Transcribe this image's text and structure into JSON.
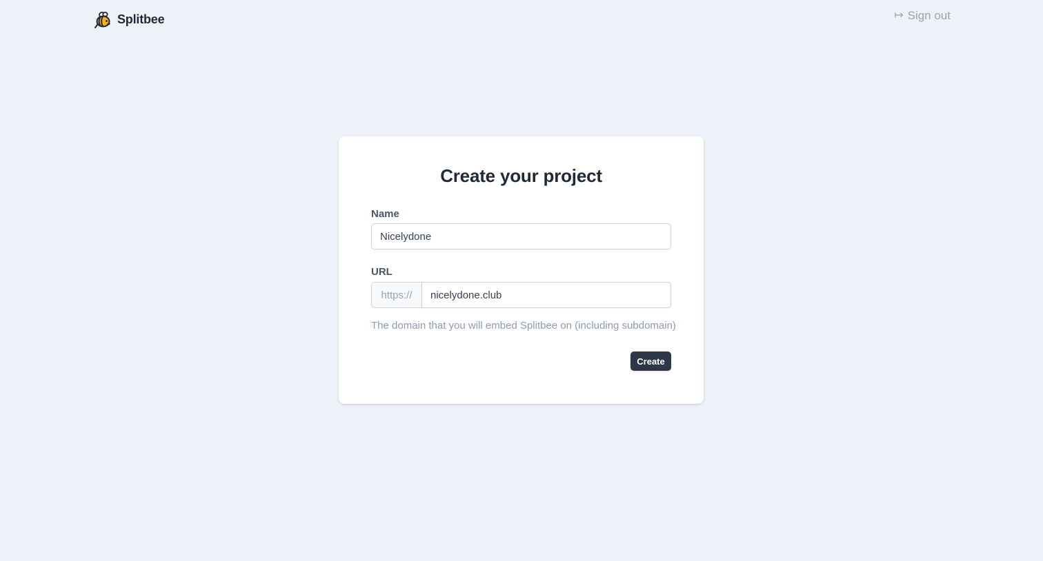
{
  "header": {
    "logo_text": "Splitbee",
    "signout_label": "Sign out",
    "signout_icon": "sign-out-icon",
    "logo_icon": "bee-icon"
  },
  "form": {
    "title": "Create your project",
    "name_label": "Name",
    "name_value": "Nicelydone",
    "url_label": "URL",
    "url_prefix": "https://",
    "url_value": "nicelydone.club",
    "helper_text": "The domain that you will embed Splitbee on (including subdomain)",
    "submit_label": "Create"
  },
  "colors": {
    "background": "#edf1f8",
    "card": "#ffffff",
    "button": "#2d3748",
    "bee_yellow": "#f6b11f"
  }
}
